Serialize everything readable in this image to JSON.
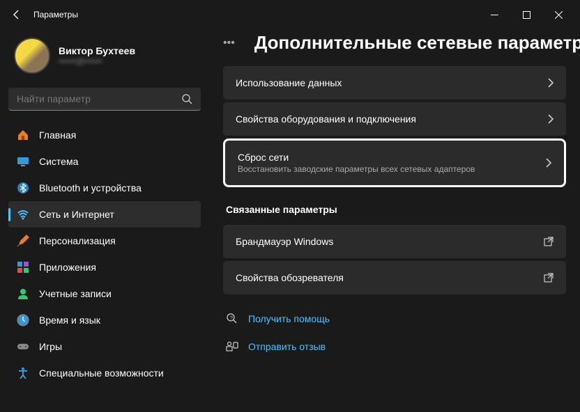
{
  "window": {
    "title": "Параметры"
  },
  "user": {
    "name": "Виктор Бухтеев",
    "email": "••••••@••••••"
  },
  "search": {
    "placeholder": "Найти параметр"
  },
  "nav": [
    {
      "label": "Главная",
      "icon": "home"
    },
    {
      "label": "Система",
      "icon": "system"
    },
    {
      "label": "Bluetooth и устройства",
      "icon": "bluetooth"
    },
    {
      "label": "Сеть и Интернет",
      "icon": "network",
      "active": true
    },
    {
      "label": "Персонализация",
      "icon": "personalize"
    },
    {
      "label": "Приложения",
      "icon": "apps"
    },
    {
      "label": "Учетные записи",
      "icon": "accounts"
    },
    {
      "label": "Время и язык",
      "icon": "time"
    },
    {
      "label": "Игры",
      "icon": "gaming"
    },
    {
      "label": "Специальные возможности",
      "icon": "accessibility"
    }
  ],
  "page": {
    "title": "Дополнительные сетевые параметры"
  },
  "cards": [
    {
      "title": "Использование данных"
    },
    {
      "title": "Свойства оборудования и подключения"
    },
    {
      "title": "Сброс сети",
      "sub": "Восстановить заводские параметры всех сетевых адаптеров",
      "highlighted": true
    }
  ],
  "related": {
    "title": "Связанные параметры",
    "items": [
      {
        "title": "Брандмауэр Windows"
      },
      {
        "title": "Свойства обозревателя"
      }
    ]
  },
  "help": [
    {
      "label": "Получить помощь"
    },
    {
      "label": "Отправить отзыв"
    }
  ]
}
